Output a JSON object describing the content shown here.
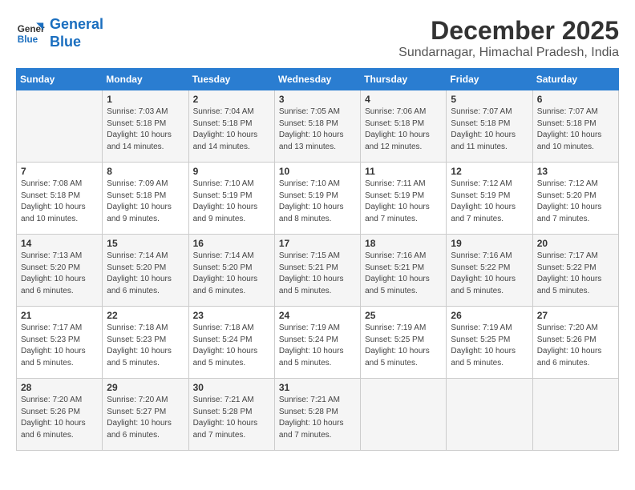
{
  "logo": {
    "line1": "General",
    "line2": "Blue"
  },
  "title": "December 2025",
  "subtitle": "Sundarnagar, Himachal Pradesh, India",
  "weekdays": [
    "Sunday",
    "Monday",
    "Tuesday",
    "Wednesday",
    "Thursday",
    "Friday",
    "Saturday"
  ],
  "weeks": [
    [
      {
        "day": "",
        "info": ""
      },
      {
        "day": "1",
        "info": "Sunrise: 7:03 AM\nSunset: 5:18 PM\nDaylight: 10 hours\nand 14 minutes."
      },
      {
        "day": "2",
        "info": "Sunrise: 7:04 AM\nSunset: 5:18 PM\nDaylight: 10 hours\nand 14 minutes."
      },
      {
        "day": "3",
        "info": "Sunrise: 7:05 AM\nSunset: 5:18 PM\nDaylight: 10 hours\nand 13 minutes."
      },
      {
        "day": "4",
        "info": "Sunrise: 7:06 AM\nSunset: 5:18 PM\nDaylight: 10 hours\nand 12 minutes."
      },
      {
        "day": "5",
        "info": "Sunrise: 7:07 AM\nSunset: 5:18 PM\nDaylight: 10 hours\nand 11 minutes."
      },
      {
        "day": "6",
        "info": "Sunrise: 7:07 AM\nSunset: 5:18 PM\nDaylight: 10 hours\nand 10 minutes."
      }
    ],
    [
      {
        "day": "7",
        "info": "Sunrise: 7:08 AM\nSunset: 5:18 PM\nDaylight: 10 hours\nand 10 minutes."
      },
      {
        "day": "8",
        "info": "Sunrise: 7:09 AM\nSunset: 5:18 PM\nDaylight: 10 hours\nand 9 minutes."
      },
      {
        "day": "9",
        "info": "Sunrise: 7:10 AM\nSunset: 5:19 PM\nDaylight: 10 hours\nand 9 minutes."
      },
      {
        "day": "10",
        "info": "Sunrise: 7:10 AM\nSunset: 5:19 PM\nDaylight: 10 hours\nand 8 minutes."
      },
      {
        "day": "11",
        "info": "Sunrise: 7:11 AM\nSunset: 5:19 PM\nDaylight: 10 hours\nand 7 minutes."
      },
      {
        "day": "12",
        "info": "Sunrise: 7:12 AM\nSunset: 5:19 PM\nDaylight: 10 hours\nand 7 minutes."
      },
      {
        "day": "13",
        "info": "Sunrise: 7:12 AM\nSunset: 5:20 PM\nDaylight: 10 hours\nand 7 minutes."
      }
    ],
    [
      {
        "day": "14",
        "info": "Sunrise: 7:13 AM\nSunset: 5:20 PM\nDaylight: 10 hours\nand 6 minutes."
      },
      {
        "day": "15",
        "info": "Sunrise: 7:14 AM\nSunset: 5:20 PM\nDaylight: 10 hours\nand 6 minutes."
      },
      {
        "day": "16",
        "info": "Sunrise: 7:14 AM\nSunset: 5:20 PM\nDaylight: 10 hours\nand 6 minutes."
      },
      {
        "day": "17",
        "info": "Sunrise: 7:15 AM\nSunset: 5:21 PM\nDaylight: 10 hours\nand 5 minutes."
      },
      {
        "day": "18",
        "info": "Sunrise: 7:16 AM\nSunset: 5:21 PM\nDaylight: 10 hours\nand 5 minutes."
      },
      {
        "day": "19",
        "info": "Sunrise: 7:16 AM\nSunset: 5:22 PM\nDaylight: 10 hours\nand 5 minutes."
      },
      {
        "day": "20",
        "info": "Sunrise: 7:17 AM\nSunset: 5:22 PM\nDaylight: 10 hours\nand 5 minutes."
      }
    ],
    [
      {
        "day": "21",
        "info": "Sunrise: 7:17 AM\nSunset: 5:23 PM\nDaylight: 10 hours\nand 5 minutes."
      },
      {
        "day": "22",
        "info": "Sunrise: 7:18 AM\nSunset: 5:23 PM\nDaylight: 10 hours\nand 5 minutes."
      },
      {
        "day": "23",
        "info": "Sunrise: 7:18 AM\nSunset: 5:24 PM\nDaylight: 10 hours\nand 5 minutes."
      },
      {
        "day": "24",
        "info": "Sunrise: 7:19 AM\nSunset: 5:24 PM\nDaylight: 10 hours\nand 5 minutes."
      },
      {
        "day": "25",
        "info": "Sunrise: 7:19 AM\nSunset: 5:25 PM\nDaylight: 10 hours\nand 5 minutes."
      },
      {
        "day": "26",
        "info": "Sunrise: 7:19 AM\nSunset: 5:25 PM\nDaylight: 10 hours\nand 5 minutes."
      },
      {
        "day": "27",
        "info": "Sunrise: 7:20 AM\nSunset: 5:26 PM\nDaylight: 10 hours\nand 6 minutes."
      }
    ],
    [
      {
        "day": "28",
        "info": "Sunrise: 7:20 AM\nSunset: 5:26 PM\nDaylight: 10 hours\nand 6 minutes."
      },
      {
        "day": "29",
        "info": "Sunrise: 7:20 AM\nSunset: 5:27 PM\nDaylight: 10 hours\nand 6 minutes."
      },
      {
        "day": "30",
        "info": "Sunrise: 7:21 AM\nSunset: 5:28 PM\nDaylight: 10 hours\nand 7 minutes."
      },
      {
        "day": "31",
        "info": "Sunrise: 7:21 AM\nSunset: 5:28 PM\nDaylight: 10 hours\nand 7 minutes."
      },
      {
        "day": "",
        "info": ""
      },
      {
        "day": "",
        "info": ""
      },
      {
        "day": "",
        "info": ""
      }
    ]
  ]
}
